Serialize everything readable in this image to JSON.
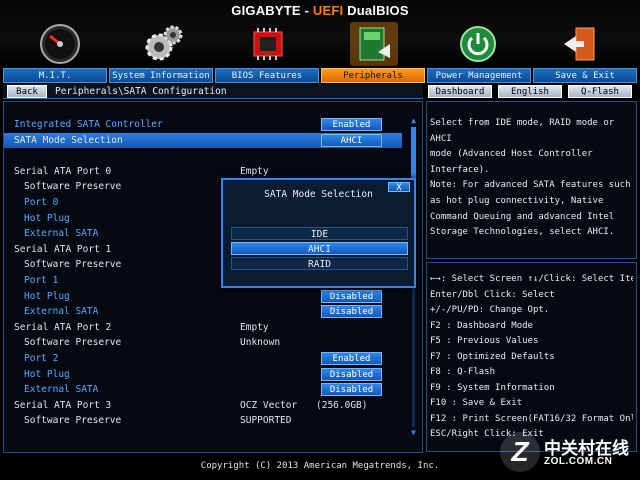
{
  "header": {
    "brand_a": "GIGABYTE - ",
    "brand_b": "UEFI",
    "brand_c": " DualBIOS"
  },
  "header_icons": [
    "speedometer-icon",
    "gears-icon",
    "chip-icon",
    "peripherals-icon",
    "power-icon",
    "save-exit-icon"
  ],
  "tabs": [
    {
      "label": "M.I.T.",
      "active": false
    },
    {
      "label": "System Information",
      "active": false
    },
    {
      "label": "BIOS Features",
      "active": false
    },
    {
      "label": "Peripherals",
      "active": true
    },
    {
      "label": "Power Management",
      "active": false
    },
    {
      "label": "Save & Exit",
      "active": false
    }
  ],
  "nav": {
    "back": "Back",
    "breadcrumb": "Peripherals\\SATA Configuration",
    "dashboard": "Dashboard",
    "language": "English",
    "qflash": "Q-Flash"
  },
  "main": {
    "rows": [
      {
        "label": "Integrated SATA Controller",
        "lvl": 0,
        "blue": true,
        "pill": "Enabled",
        "value": "",
        "value2": "",
        "selected": false
      },
      {
        "label": "SATA Mode Selection",
        "lvl": 0,
        "blue": false,
        "pill": "AHCI",
        "value": "",
        "value2": "",
        "selected": true
      },
      {
        "label": "",
        "lvl": 0,
        "blue": false,
        "pill": "",
        "value": "",
        "value2": "",
        "selected": false
      },
      {
        "label": "Serial ATA Port 0",
        "lvl": 0,
        "blue": false,
        "pill": "",
        "value": "Empty",
        "value2": "",
        "selected": false
      },
      {
        "label": "Software Preserve",
        "lvl": 1,
        "blue": false,
        "pill": "",
        "value": "",
        "value2": "",
        "selected": false
      },
      {
        "label": "Port 0",
        "lvl": 1,
        "blue": true,
        "pill": "",
        "value": "",
        "value2": "",
        "selected": false
      },
      {
        "label": "Hot Plug",
        "lvl": 1,
        "blue": true,
        "pill": "Disabled",
        "value": "",
        "value2": "",
        "selected": false
      },
      {
        "label": "External SATA",
        "lvl": 1,
        "blue": true,
        "pill": "",
        "value": "",
        "value2": "",
        "selected": false
      },
      {
        "label": "Serial ATA Port 1",
        "lvl": 0,
        "blue": false,
        "pill": "",
        "value": "",
        "value2": "",
        "selected": false
      },
      {
        "label": "Software Preserve",
        "lvl": 1,
        "blue": false,
        "pill": "",
        "value": "",
        "value2": "",
        "selected": false
      },
      {
        "label": "Port 1",
        "lvl": 1,
        "blue": true,
        "pill": "Enabled",
        "value": "",
        "value2": "",
        "selected": false
      },
      {
        "label": "Hot Plug",
        "lvl": 1,
        "blue": true,
        "pill": "Disabled",
        "value": "",
        "value2": "",
        "selected": false
      },
      {
        "label": "External SATA",
        "lvl": 1,
        "blue": true,
        "pill": "Disabled",
        "value": "",
        "value2": "",
        "selected": false
      },
      {
        "label": "Serial ATA Port 2",
        "lvl": 0,
        "blue": false,
        "pill": "",
        "value": "Empty",
        "value2": "",
        "selected": false
      },
      {
        "label": "Software Preserve",
        "lvl": 1,
        "blue": false,
        "pill": "",
        "value": "Unknown",
        "value2": "",
        "selected": false
      },
      {
        "label": "Port 2",
        "lvl": 1,
        "blue": true,
        "pill": "Enabled",
        "value": "",
        "value2": "",
        "selected": false
      },
      {
        "label": "Hot Plug",
        "lvl": 1,
        "blue": true,
        "pill": "Disabled",
        "value": "",
        "value2": "",
        "selected": false
      },
      {
        "label": "External SATA",
        "lvl": 1,
        "blue": true,
        "pill": "Disabled",
        "value": "",
        "value2": "",
        "selected": false
      },
      {
        "label": "Serial ATA Port 3",
        "lvl": 0,
        "blue": false,
        "pill": "",
        "value": "OCZ Vector",
        "value2": "(256.0GB)",
        "selected": false
      },
      {
        "label": "Software Preserve",
        "lvl": 1,
        "blue": false,
        "pill": "",
        "value": "SUPPORTED",
        "value2": "",
        "selected": false
      }
    ]
  },
  "popup": {
    "title": "SATA Mode Selection",
    "close": "X",
    "options": [
      {
        "label": "IDE",
        "selected": false
      },
      {
        "label": "AHCI",
        "selected": true
      },
      {
        "label": "RAID",
        "selected": false
      }
    ]
  },
  "help": [
    "Select from IDE mode, RAID mode or AHCI",
    "mode (Advanced Host Controller",
    "Interface).",
    "Note: For advanced SATA features such",
    "as hot plug connectivity, Native",
    "Command Queuing and advanced Intel",
    "Storage Technologies, select AHCI."
  ],
  "keys": [
    "←→: Select Screen  ↑↓/Click: Select Item",
    "Enter/Dbl Click: Select",
    "+/-/PU/PD: Change Opt.",
    "F2  : Dashboard Mode",
    "F5  : Previous Values",
    "F7  : Optimized Defaults",
    "F8  : Q-Flash",
    "F9  : System Information",
    "F10 : Save & Exit",
    "F12 : Print Screen(FAT16/32 Format Only)",
    "ESC/Right Click: Exit"
  ],
  "footer": "Copyright (C) 2013 American Megatrends, Inc.",
  "watermark": {
    "cn": "中关村在线",
    "url": "ZOL.COM.CN"
  },
  "colors": {
    "accent": "#2f86ee",
    "active_tab": "#ff9a1f",
    "brand_uefi": "#ff7a00"
  }
}
